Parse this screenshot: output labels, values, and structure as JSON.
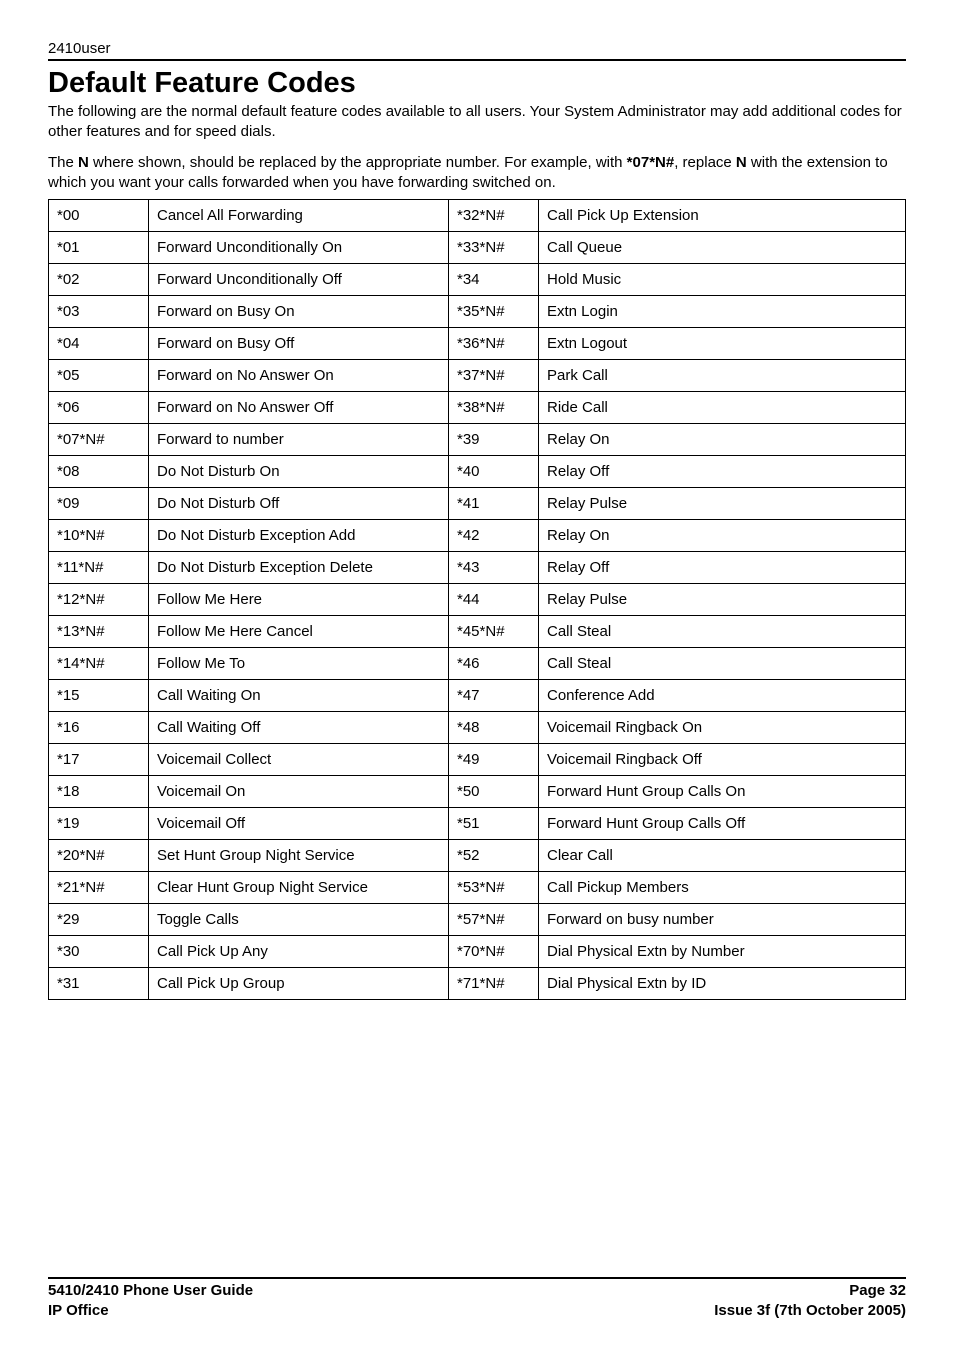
{
  "header": {
    "doc_id": "2410user"
  },
  "title": "Default Feature Codes",
  "intro_para1_part1": "The following are the normal default feature codes available to all users. Your System Administrator may add additional codes for other features and for speed dials.",
  "intro_para2_part1": "The ",
  "intro_para2_bold1": "N",
  "intro_para2_part2": " where shown, should be replaced by the appropriate number. For example, with ",
  "intro_para2_bold2": "*07*N#",
  "intro_para2_part3": ", replace ",
  "intro_para2_bold3": "N",
  "intro_para2_part4": " with the extension to which you want your calls forwarded when you have forwarding switched on.",
  "rows": [
    {
      "c1": "*00",
      "d1": "Cancel All Forwarding",
      "c2": "*32*N#",
      "d2": "Call Pick Up Extension"
    },
    {
      "c1": "*01",
      "d1": "Forward Unconditionally On",
      "c2": "*33*N#",
      "d2": "Call Queue"
    },
    {
      "c1": "*02",
      "d1": "Forward Unconditionally Off",
      "c2": "*34",
      "d2": "Hold Music"
    },
    {
      "c1": "*03",
      "d1": "Forward on Busy On",
      "c2": "*35*N#",
      "d2": "Extn Login"
    },
    {
      "c1": "*04",
      "d1": "Forward on Busy Off",
      "c2": "*36*N#",
      "d2": "Extn Logout"
    },
    {
      "c1": "*05",
      "d1": "Forward on No Answer On",
      "c2": "*37*N#",
      "d2": "Park Call"
    },
    {
      "c1": "*06",
      "d1": "Forward on No Answer Off",
      "c2": "*38*N#",
      "d2": "Ride Call"
    },
    {
      "c1": "*07*N#",
      "d1": "Forward to number",
      "c2": "*39",
      "d2": "Relay On"
    },
    {
      "c1": "*08",
      "d1": "Do Not Disturb On",
      "c2": "*40",
      "d2": "Relay Off"
    },
    {
      "c1": "*09",
      "d1": "Do Not Disturb Off",
      "c2": "*41",
      "d2": "Relay Pulse"
    },
    {
      "c1": "*10*N#",
      "d1": "Do Not Disturb Exception Add",
      "c2": "*42",
      "d2": "Relay On"
    },
    {
      "c1": "*11*N#",
      "d1": "Do Not Disturb Exception Delete",
      "c2": "*43",
      "d2": "Relay Off"
    },
    {
      "c1": "*12*N#",
      "d1": "Follow Me Here",
      "c2": "*44",
      "d2": "Relay Pulse"
    },
    {
      "c1": "*13*N#",
      "d1": "Follow Me Here Cancel",
      "c2": "*45*N#",
      "d2": "Call Steal"
    },
    {
      "c1": "*14*N#",
      "d1": "Follow Me To",
      "c2": "*46",
      "d2": "Call Steal"
    },
    {
      "c1": "*15",
      "d1": "Call Waiting On",
      "c2": "*47",
      "d2": "Conference Add"
    },
    {
      "c1": "*16",
      "d1": "Call Waiting Off",
      "c2": "*48",
      "d2": "Voicemail Ringback On"
    },
    {
      "c1": "*17",
      "d1": "Voicemail Collect",
      "c2": "*49",
      "d2": "Voicemail Ringback Off"
    },
    {
      "c1": "*18",
      "d1": "Voicemail On",
      "c2": "*50",
      "d2": "Forward Hunt Group Calls On"
    },
    {
      "c1": "*19",
      "d1": "Voicemail Off",
      "c2": "*51",
      "d2": "Forward Hunt Group Calls Off"
    },
    {
      "c1": "*20*N#",
      "d1": "Set Hunt Group Night Service",
      "c2": "*52",
      "d2": "Clear Call"
    },
    {
      "c1": "*21*N#",
      "d1": "Clear Hunt Group Night Service",
      "c2": "*53*N#",
      "d2": "Call Pickup Members"
    },
    {
      "c1": "*29",
      "d1": "Toggle Calls",
      "c2": "*57*N#",
      "d2": "Forward on busy number"
    },
    {
      "c1": "*30",
      "d1": "Call Pick Up Any",
      "c2": "*70*N#",
      "d2": "Dial Physical Extn by Number"
    },
    {
      "c1": "*31",
      "d1": "Call Pick Up Group",
      "c2": "*71*N#",
      "d2": "Dial Physical Extn by ID"
    }
  ],
  "footer": {
    "left1": "5410/2410 Phone User Guide",
    "left2": "IP Office",
    "right1": "Page 32",
    "right2": "Issue 3f (7th October 2005)"
  }
}
